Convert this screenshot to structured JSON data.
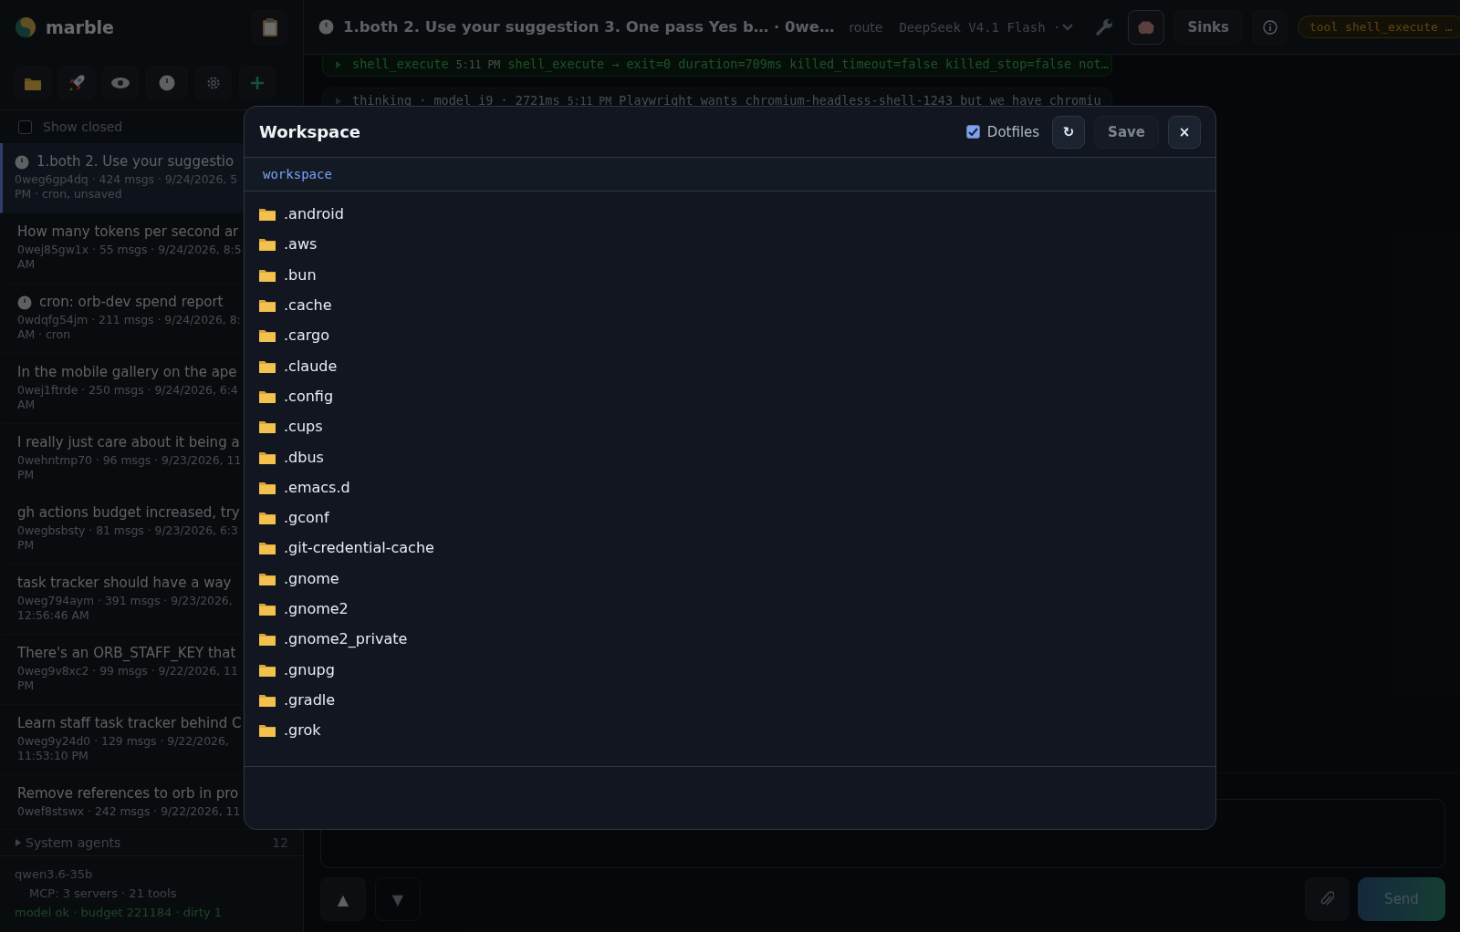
{
  "app": {
    "name": "marble"
  },
  "show_closed": {
    "label": "Show closed",
    "checked": false
  },
  "sessions": [
    {
      "title": "1.both 2. Use your suggestio",
      "meta": [
        "0weg6gp4dq · 424 msgs · 9/24/2026, 5",
        "PM · cron, unsaved"
      ],
      "cron": true,
      "selected": true
    },
    {
      "title": "How many tokens per second ar",
      "meta": [
        "0wej85gw1x · 55 msgs · 9/24/2026, 8:5",
        "AM"
      ],
      "cron": false,
      "selected": false
    },
    {
      "title": "cron: orb-dev spend report",
      "meta": [
        "0wdqfg54jm · 211 msgs · 9/24/2026, 8:",
        "AM · cron"
      ],
      "cron": true,
      "selected": false
    },
    {
      "title": "In the mobile gallery on the ape",
      "meta": [
        "0wej1ftrde · 250 msgs · 9/24/2026, 6:4",
        "AM"
      ],
      "cron": false,
      "selected": false
    },
    {
      "title": "I really just care about it being a",
      "meta": [
        "0wehntmp70 · 96 msgs · 9/23/2026, 11",
        "PM"
      ],
      "cron": false,
      "selected": false
    },
    {
      "title": "gh actions budget increased, try",
      "meta": [
        "0wegbsbsty · 81 msgs · 9/23/2026, 6:3",
        "PM"
      ],
      "cron": false,
      "selected": false
    },
    {
      "title": "task tracker should have a way",
      "meta": [
        "0weg794aym · 391 msgs · 9/23/2026,",
        "12:56:46 AM"
      ],
      "cron": false,
      "selected": false
    },
    {
      "title": "There's an ORB_STAFF_KEY that",
      "meta": [
        "0weg9v8xc2 · 99 msgs · 9/22/2026, 11",
        "PM"
      ],
      "cron": false,
      "selected": false
    },
    {
      "title": "Learn staff task tracker behind C",
      "meta": [
        "0weg9y24d0 · 129 msgs · 9/22/2026,",
        "11:53:10 PM"
      ],
      "cron": false,
      "selected": false
    },
    {
      "title": "Remove references to orb in pro",
      "meta": [
        "0wef8stswx · 242 msgs · 9/22/2026, 11"
      ],
      "cron": false,
      "selected": false
    }
  ],
  "system_agents": {
    "label": "System agents",
    "count": "12",
    "expanded": false
  },
  "status": {
    "model": "qwen3.6-35b",
    "mcp": "MCP: 3 servers · 21 tools",
    "health": "model ok · budget 221184 · dirty 1"
  },
  "topbar": {
    "title": "1.both 2. Use your suggestion 3. One pass Yes b… · 0we…",
    "route": "route",
    "model": "DeepSeek V4.1 Flash ·",
    "sinks": "Sinks",
    "tool_pill": "tool shell_execute …"
  },
  "log": [
    {
      "kind": "tool",
      "name": "shell_execute",
      "time": "5:11 PM",
      "text": "shell_execute → exit=0 duration=709ms killed_timeout=false killed_stop=false not…"
    },
    {
      "kind": "thinking",
      "name": "thinking · model i9 · 2721ms",
      "time": "5:11 PM",
      "text": "Playwright wants chromium-headless-shell-1243 but we have chromiu"
    }
  ],
  "composer": {
    "buttons": [
      {
        "label": "▲",
        "disabled": false
      },
      {
        "label": "▼",
        "disabled": true
      }
    ],
    "send": "Send"
  },
  "modal": {
    "title": "Workspace",
    "dotfiles": {
      "label": "Dotfiles",
      "checked": true
    },
    "refresh": "↻",
    "save": {
      "label": "Save",
      "disabled": true
    },
    "close": "×",
    "path": "workspace",
    "entries": [
      {
        "name": ".android",
        "kind": "folder"
      },
      {
        "name": ".aws",
        "kind": "folder"
      },
      {
        "name": ".bun",
        "kind": "folder"
      },
      {
        "name": ".cache",
        "kind": "folder"
      },
      {
        "name": ".cargo",
        "kind": "folder"
      },
      {
        "name": ".claude",
        "kind": "folder"
      },
      {
        "name": ".config",
        "kind": "folder"
      },
      {
        "name": ".cups",
        "kind": "folder"
      },
      {
        "name": ".dbus",
        "kind": "folder"
      },
      {
        "name": ".emacs.d",
        "kind": "folder"
      },
      {
        "name": ".gconf",
        "kind": "folder"
      },
      {
        "name": ".git-credential-cache",
        "kind": "folder"
      },
      {
        "name": ".gnome",
        "kind": "folder"
      },
      {
        "name": ".gnome2",
        "kind": "folder"
      },
      {
        "name": ".gnome2_private",
        "kind": "folder"
      },
      {
        "name": ".gnupg",
        "kind": "folder"
      },
      {
        "name": ".gradle",
        "kind": "folder"
      },
      {
        "name": ".grok",
        "kind": "folder"
      }
    ]
  }
}
